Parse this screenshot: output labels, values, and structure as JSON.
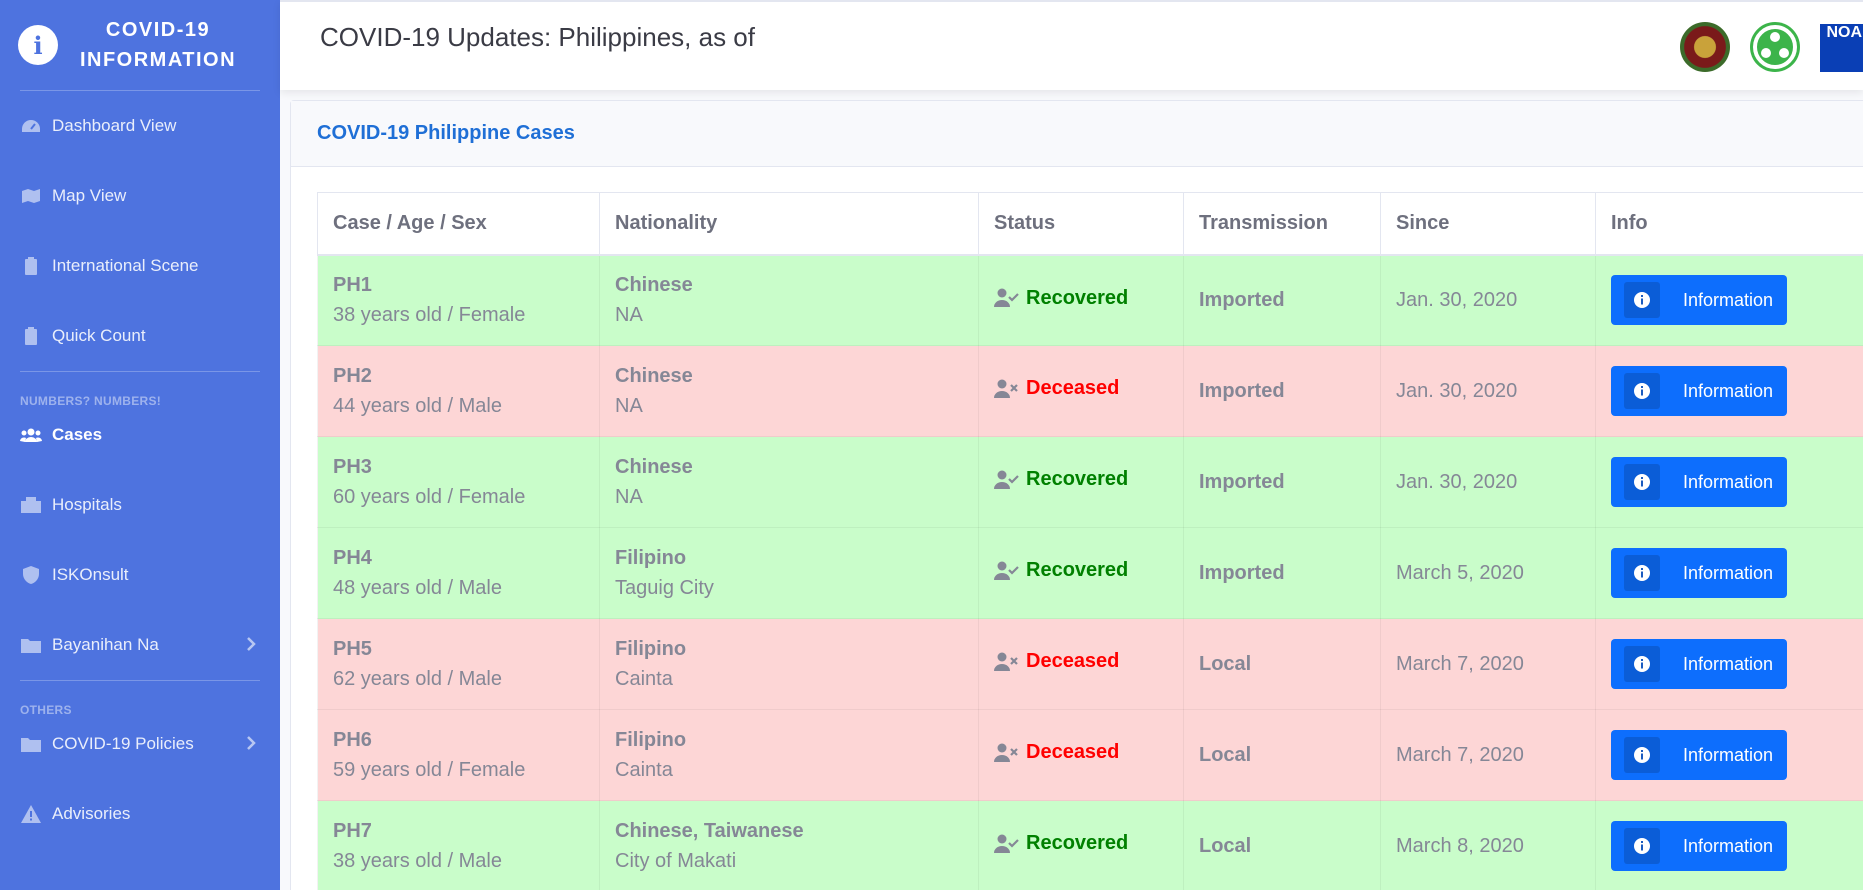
{
  "sidebar": {
    "brand_line1": "COVID-19",
    "brand_line2": "INFORMATION",
    "items_main": [
      {
        "label": "Dashboard View",
        "icon": "tachometer-icon"
      },
      {
        "label": "Map View",
        "icon": "map-icon"
      },
      {
        "label": "International Scene",
        "icon": "clipboard-icon"
      },
      {
        "label": "Quick Count",
        "icon": "clipboard-icon"
      }
    ],
    "section1": "NUMBERS? NUMBERS!",
    "items_numbers": [
      {
        "label": "Cases",
        "icon": "users-icon",
        "active": true
      },
      {
        "label": "Hospitals",
        "icon": "hospital-icon"
      },
      {
        "label": "ISKOnsult",
        "icon": "shield-icon"
      },
      {
        "label": "Bayanihan Na",
        "icon": "folder-icon",
        "has_chevron": true
      }
    ],
    "section2": "OTHERS",
    "items_others": [
      {
        "label": "COVID-19 Policies",
        "icon": "folder-icon",
        "has_chevron": true
      },
      {
        "label": "Advisories",
        "icon": "warning-icon"
      }
    ]
  },
  "topbar": {
    "title": "COVID-19 Updates: Philippines, as of",
    "logo_noah_text": "NOAH"
  },
  "card": {
    "title": "COVID-19 Philippine Cases"
  },
  "table": {
    "headers": [
      "Case / Age / Sex",
      "Nationality",
      "Status",
      "Transmission",
      "Since",
      "Info"
    ],
    "button_label": "Information",
    "rows": [
      {
        "case": "PH1",
        "age_sex": "38 years old / Female",
        "nationality": "Chinese",
        "location": "NA",
        "status": "Recovered",
        "transmission": "Imported",
        "since": "Jan. 30, 2020"
      },
      {
        "case": "PH2",
        "age_sex": "44 years old / Male",
        "nationality": "Chinese",
        "location": "NA",
        "status": "Deceased",
        "transmission": "Imported",
        "since": "Jan. 30, 2020"
      },
      {
        "case": "PH3",
        "age_sex": "60 years old / Female",
        "nationality": "Chinese",
        "location": "NA",
        "status": "Recovered",
        "transmission": "Imported",
        "since": "Jan. 30, 2020"
      },
      {
        "case": "PH4",
        "age_sex": "48 years old / Male",
        "nationality": "Filipino",
        "location": "Taguig City",
        "status": "Recovered",
        "transmission": "Imported",
        "since": "March 5, 2020"
      },
      {
        "case": "PH5",
        "age_sex": "62 years old / Male",
        "nationality": "Filipino",
        "location": "Cainta",
        "status": "Deceased",
        "transmission": "Local",
        "since": "March 7, 2020"
      },
      {
        "case": "PH6",
        "age_sex": "59 years old / Female",
        "nationality": "Filipino",
        "location": "Cainta",
        "status": "Deceased",
        "transmission": "Local",
        "since": "March 7, 2020"
      },
      {
        "case": "PH7",
        "age_sex": "38 years old / Male",
        "nationality": "Chinese, Taiwanese",
        "location": "City of Makati",
        "status": "Recovered",
        "transmission": "Local",
        "since": "March 8, 2020"
      }
    ]
  },
  "colors": {
    "sidebar": "#4e73df",
    "recovered_row": "#c9fdca",
    "deceased_row": "#fdd6d6",
    "recovered_text": "#008000",
    "deceased_text": "#ff0000",
    "button": "#0d6efd"
  }
}
